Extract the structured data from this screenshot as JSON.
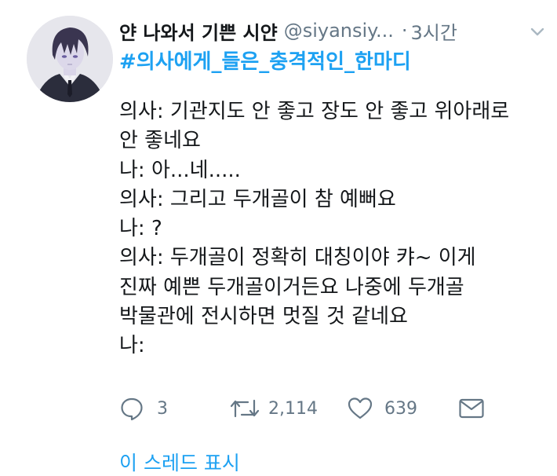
{
  "tweet": {
    "display_name": "얀 나와서 기쁜 시얀",
    "handle": "@siyansiy...",
    "separator": "·",
    "time": "3시간",
    "hashtag": "#의사에게_들은_충격적인_한마디",
    "lines": [
      "의사: 기관지도 안 좋고 장도 안 좋고 위아래로",
      "안 좋네요",
      "나: 아...네.....",
      "의사: 그리고 두개골이 참 예뻐요",
      "나: ?",
      "의사: 두개골이 정확히 대칭이야 캬~ 이게",
      "진짜 예쁜 두개골이거든요 나중에 두개골",
      "박물관에 전시하면 멋질 것 같네요",
      "나:"
    ]
  },
  "actions": {
    "reply": {
      "icon": "reply-icon",
      "count": "3"
    },
    "retweet": {
      "icon": "retweet-icon",
      "count": "2,114"
    },
    "like": {
      "icon": "heart-icon",
      "count": "639"
    },
    "dm": {
      "icon": "envelope-icon"
    }
  },
  "thread_link": "이 스레드 표시",
  "colors": {
    "link": "#1da1f2",
    "text": "#14171a",
    "muted": "#657786"
  }
}
